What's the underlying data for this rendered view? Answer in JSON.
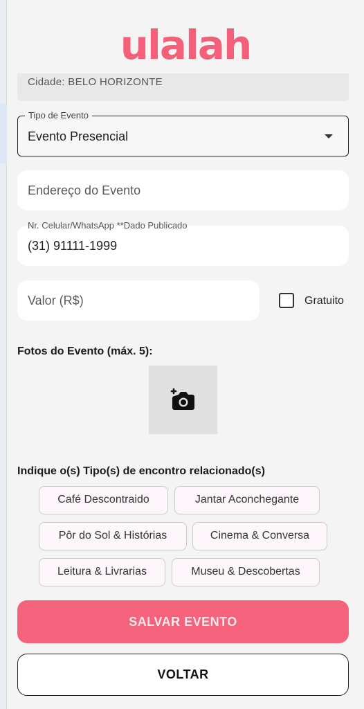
{
  "app": {
    "logo_text": "ulalah",
    "brand_color": "#f4607a"
  },
  "form": {
    "cidade_text": "Cidade: BELO HORIZONTE",
    "tipo_evento": {
      "label": "Tipo de Evento",
      "value": "Evento Presencial"
    },
    "endereco": {
      "placeholder": "Endereço do Evento",
      "value": ""
    },
    "celular": {
      "label": "Nr. Celular/WhatsApp **Dado Publicado",
      "value": "(31) 91111-1999"
    },
    "valor": {
      "placeholder": "Valor (R$)",
      "value": ""
    },
    "gratuito": {
      "label": "Gratuito",
      "checked": false
    },
    "fotos": {
      "title": "Fotos do Evento (máx. 5):",
      "add_icon": "add-photo-icon"
    },
    "tipos_encontro": {
      "title": "Indique o(s) Tipo(s) de encontro relacionado(s)",
      "chips": [
        "Café Descontraido",
        "Jantar Aconchegante",
        "Pôr do Sol & Histórias",
        "Cinema & Conversa",
        "Leitura & Livrarias",
        "Museu & Descobertas"
      ]
    }
  },
  "actions": {
    "save_label": "SALVAR EVENTO",
    "back_label": "VOLTAR"
  }
}
